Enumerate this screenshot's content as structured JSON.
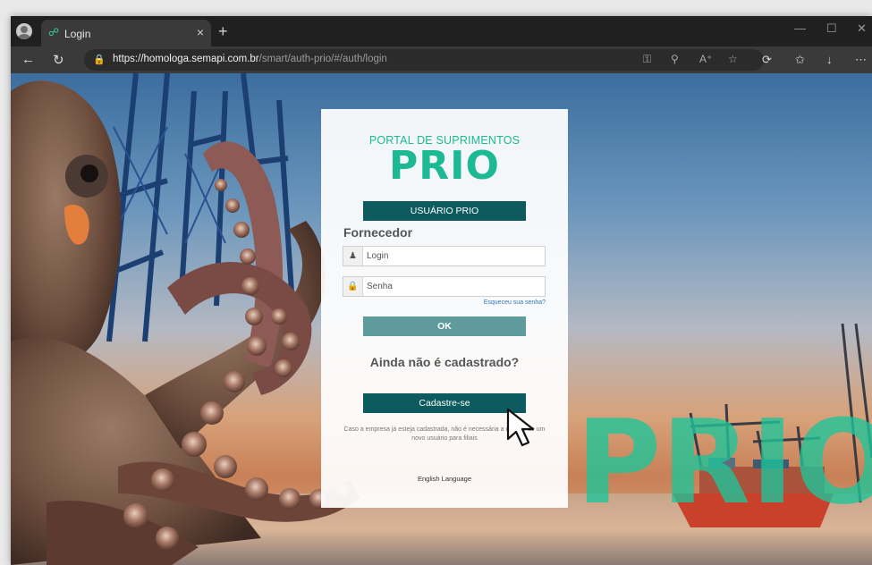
{
  "browser": {
    "tab_title": "Login",
    "tab_favicon": "☍",
    "tab_close": "×",
    "new_tab": "+",
    "url_host": "https://homologa.semapi.com.br",
    "url_path": "/smart/auth-prio/#/auth/login",
    "window_controls": [
      "—",
      "☐",
      "✕"
    ],
    "icons": [
      "profile-icon",
      "back-icon",
      "refresh-icon",
      "lock-icon",
      "key-icon",
      "zoom-icon",
      "read-aloud-icon",
      "favorite-icon",
      "extensions-icon",
      "favorites-icon",
      "downloads-icon",
      "more-icon"
    ]
  },
  "login": {
    "portal_title": "PORTAL DE SUPRIMENTOS",
    "logo_text": "PRIO",
    "usuario_button": "USUÁRIO PRIO",
    "section_label": "Fornecedor",
    "login_placeholder": "Login",
    "senha_placeholder": "Senha",
    "forgot_link": "Esqueceu sua senha?",
    "ok_button": "OK",
    "not_registered": "Ainda não é cadastrado?",
    "register_button": "Cadastre-se",
    "note": "Caso a empresa já esteja cadastrada, não é necessária a criação de um novo usuário para filiais",
    "language_link": "English Language"
  },
  "background": {
    "watermark_text": "PRIO"
  },
  "colors": {
    "brand_green": "#1db995",
    "button_teal": "#0e5b5f",
    "ok_teal": "#5f9b9d"
  }
}
